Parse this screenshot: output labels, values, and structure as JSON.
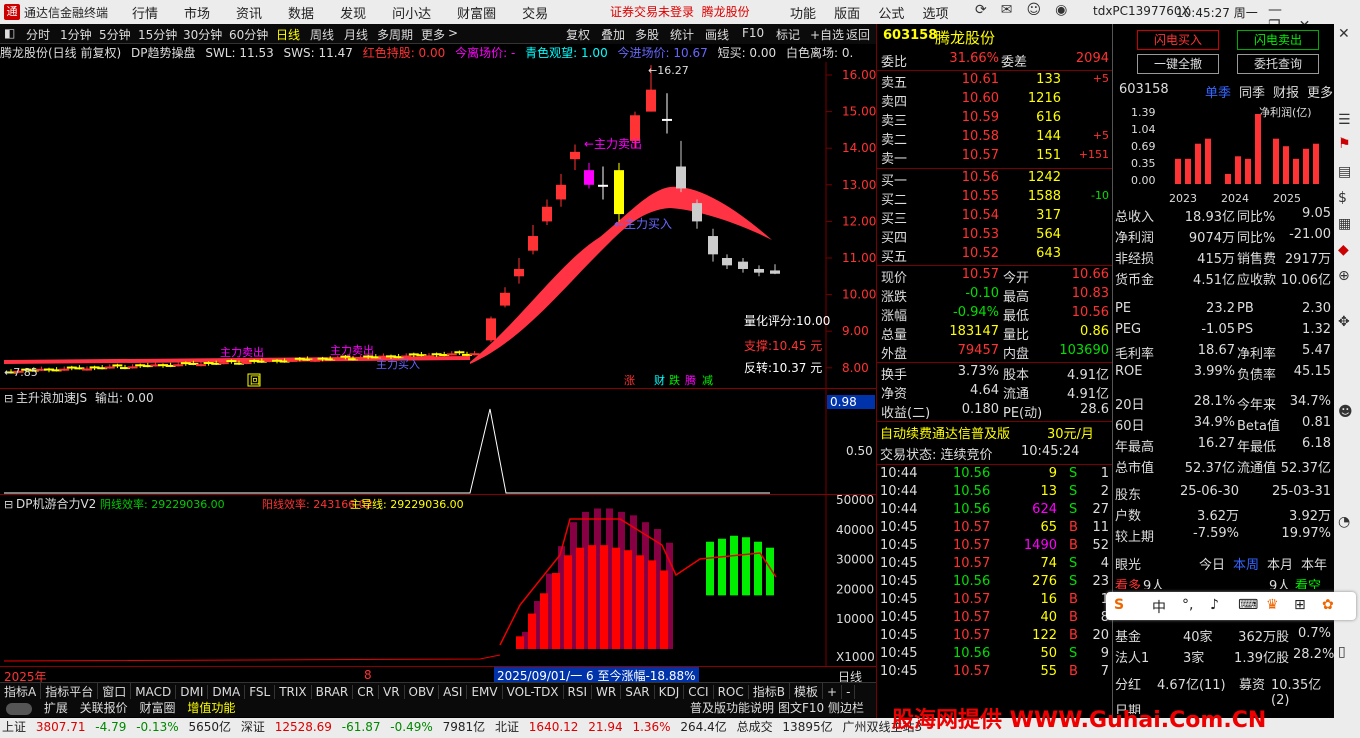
{
  "title_bar": {
    "app_name": "通达信金融终端",
    "menu": [
      "行情",
      "市场",
      "资讯",
      "数据",
      "发现",
      "问小达",
      "财富圈",
      "交易"
    ],
    "notice": "证券交易未登录",
    "notice_stock": "腾龙股份",
    "right_menu": [
      "功能",
      "版面",
      "公式",
      "选项"
    ],
    "user_id": "tdxPC1397760X",
    "clock": "10:45:27 周一"
  },
  "period_bar": {
    "items": [
      "分时",
      "1分钟",
      "5分钟",
      "15分钟",
      "30分钟",
      "60分钟",
      "日线",
      "周线",
      "月线",
      "多周期",
      "更多"
    ],
    "active": "日线",
    "right": [
      "复权",
      "叠加",
      "多股",
      "统计",
      "画线",
      "F10",
      "标记",
      "+自选",
      "返回"
    ]
  },
  "chart_info": {
    "name": "腾龙股份(日线 前复权)",
    "indicator": "DP趋势操盘",
    "swl": "SWL: 11.53",
    "sws": "SWS: 11.47",
    "red_hold": "红色持股: 0.00",
    "today_leave": "今离场价: -",
    "cyan_watch": "青色观望: 1.00",
    "today_enter": "今进场价: 10.67",
    "short_buy": "短买: 0.00",
    "white_leave": "白色离场: 0."
  },
  "main_chart": {
    "y_ticks": [
      "16.00",
      "15.00",
      "14.00",
      "13.00",
      "12.00",
      "11.00",
      "10.00",
      "9.00",
      "8.00"
    ],
    "high_label": "16.27",
    "low_label": "7.85",
    "annotations": [
      "←主力卖出",
      "←主力买入",
      "主力卖出",
      "主力买入",
      "主力卖出"
    ],
    "score": "量化评分:10.00",
    "support": "支撑:10.45 元",
    "reverse": "反转:10.37 元",
    "tags": [
      "涨",
      "财",
      "跌",
      "腾",
      "减"
    ],
    "marker": "回"
  },
  "sub1": {
    "name": "主升浪加速JS",
    "output": "输出: 0.00",
    "y_ticks": [
      "0.98",
      "0.50"
    ]
  },
  "sub2": {
    "name": "DP机游合力V2",
    "yin": "阴线效率: 29229036.00",
    "yang": "阳线效率: 243166.02",
    "main": "主导线: 29229036.00",
    "y_ticks": [
      "50000",
      "40000",
      "30000",
      "20000",
      "10000",
      "X1000"
    ]
  },
  "x_axis": {
    "labels": [
      "2025年",
      "8",
      "9"
    ],
    "range_note": "2025/09/01/一 6 至今涨幅-18.88%",
    "period": "日线"
  },
  "indicator_tabs": [
    "指标A",
    "指标平台",
    "窗口",
    "MACD",
    "DMI",
    "DMA",
    "FSL",
    "TRIX",
    "BRAR",
    "CR",
    "VR",
    "OBV",
    "ASI",
    "EMV",
    "VOL-TDX",
    "RSI",
    "WR",
    "SAR",
    "KDJ",
    "CCI",
    "ROC",
    "指标B",
    "模板",
    "+",
    "-"
  ],
  "bottom_tabs": [
    "扩展",
    "关联报价",
    "财富圈",
    "增值功能"
  ],
  "bottom_right": [
    "普及版功能说明",
    "图文F10",
    "侧边栏"
  ],
  "quote": {
    "code": "603158",
    "name": "腾龙股份",
    "weibi_label": "委比",
    "weibi": "31.66%",
    "weicha_label": "委差",
    "weicha": "2094",
    "asks": [
      {
        "label": "卖五",
        "price": "10.61",
        "vol": "133",
        "chg": "+5"
      },
      {
        "label": "卖四",
        "price": "10.60",
        "vol": "1216",
        "chg": ""
      },
      {
        "label": "卖三",
        "price": "10.59",
        "vol": "616",
        "chg": ""
      },
      {
        "label": "卖二",
        "price": "10.58",
        "vol": "144",
        "chg": "+5"
      },
      {
        "label": "卖一",
        "price": "10.57",
        "vol": "151",
        "chg": "+151"
      }
    ],
    "bids": [
      {
        "label": "买一",
        "price": "10.56",
        "vol": "1242",
        "chg": ""
      },
      {
        "label": "买二",
        "price": "10.55",
        "vol": "1588",
        "chg": "-10"
      },
      {
        "label": "买三",
        "price": "10.54",
        "vol": "317",
        "chg": ""
      },
      {
        "label": "买四",
        "price": "10.53",
        "vol": "564",
        "chg": ""
      },
      {
        "label": "买五",
        "price": "10.52",
        "vol": "643",
        "chg": ""
      }
    ],
    "stats": [
      {
        "l1": "现价",
        "v1": "10.57",
        "c1": "red",
        "l2": "今开",
        "v2": "10.66",
        "c2": "red"
      },
      {
        "l1": "涨跌",
        "v1": "-0.10",
        "c1": "green",
        "l2": "最高",
        "v2": "10.83",
        "c2": "red"
      },
      {
        "l1": "涨幅",
        "v1": "-0.94%",
        "c1": "green",
        "l2": "最低",
        "v2": "10.56",
        "c2": "red"
      },
      {
        "l1": "总量",
        "v1": "183147",
        "c1": "yellow",
        "l2": "量比",
        "v2": "0.86",
        "c2": "yellow"
      },
      {
        "l1": "外盘",
        "v1": "79457",
        "c1": "red",
        "l2": "内盘",
        "v2": "103690",
        "c2": "green"
      }
    ],
    "stats2": [
      {
        "l1": "换手",
        "v1": "3.73%",
        "l2": "股本",
        "v2": "4.91亿"
      },
      {
        "l1": "净资",
        "v1": "4.64",
        "l2": "流通",
        "v2": "4.91亿"
      },
      {
        "l1": "收益(二)",
        "v1": "0.180",
        "l2": "PE(动)",
        "v2": "28.6"
      }
    ],
    "promo": "自动续费通达信普及版",
    "promo_price": "30元/月",
    "trade_status": "交易状态: 连续竞价",
    "trade_time": "10:45:24",
    "ticks": [
      {
        "t": "10:44",
        "p": "10.56",
        "v": "9",
        "s": "S",
        "n": "1"
      },
      {
        "t": "10:44",
        "p": "10.56",
        "v": "13",
        "s": "S",
        "n": "2"
      },
      {
        "t": "10:44",
        "p": "10.56",
        "v": "624",
        "s": "S",
        "n": "27"
      },
      {
        "t": "10:45",
        "p": "10.57",
        "v": "65",
        "s": "B",
        "n": "11"
      },
      {
        "t": "10:45",
        "p": "10.57",
        "v": "1490",
        "s": "B",
        "n": "52"
      },
      {
        "t": "10:45",
        "p": "10.57",
        "v": "74",
        "s": "S",
        "n": "4"
      },
      {
        "t": "10:45",
        "p": "10.56",
        "v": "276",
        "s": "S",
        "n": "23"
      },
      {
        "t": "10:45",
        "p": "10.57",
        "v": "16",
        "s": "B",
        "n": "1"
      },
      {
        "t": "10:45",
        "p": "10.57",
        "v": "40",
        "s": "B",
        "n": "8"
      },
      {
        "t": "10:45",
        "p": "10.57",
        "v": "122",
        "s": "B",
        "n": "20"
      },
      {
        "t": "10:45",
        "p": "10.56",
        "v": "50",
        "s": "S",
        "n": "9"
      },
      {
        "t": "10:45",
        "p": "10.57",
        "v": "55",
        "s": "B",
        "n": "7"
      }
    ]
  },
  "rpanel": {
    "btn_flash_buy": "闪电买入",
    "btn_flash_sell": "闪电卖出",
    "btn_clear": "一键全撤",
    "btn_query": "委托查询",
    "code": "603158",
    "tabs": [
      "单季",
      "同季",
      "财报",
      "更多"
    ],
    "profit_label": "净利润(亿)",
    "mini_y": [
      "1.39",
      "1.04",
      "0.69",
      "0.35",
      "0.00"
    ],
    "mini_x": [
      "2023",
      "2024",
      "2025"
    ],
    "fin": [
      {
        "a": "总收入",
        "b": "18.93亿",
        "c": "同比%",
        "d": "9.05"
      },
      {
        "a": "净利润",
        "b": "9074万",
        "c": "同比%",
        "d": "-21.00"
      },
      {
        "a": "非经损",
        "b": "415万",
        "c": "销售费",
        "d": "2917万"
      },
      {
        "a": "货币金",
        "b": "4.51亿",
        "c": "应收款",
        "d": "10.06亿"
      }
    ],
    "fin2": [
      {
        "a": "PE",
        "b": "23.2",
        "c": "PB",
        "d": "2.30"
      },
      {
        "a": "PEG",
        "b": "-1.05",
        "c": "PS",
        "d": "1.32"
      },
      {
        "a": "毛利率",
        "b": "18.67",
        "c": "净利率",
        "d": "5.47"
      },
      {
        "a": "ROE",
        "b": "3.99%",
        "c": "负债率",
        "d": "45.15"
      }
    ],
    "fin3": [
      {
        "a": "20日",
        "b": "28.1%",
        "c": "今年来",
        "d": "34.7%"
      },
      {
        "a": "60日",
        "b": "34.9%",
        "c": "Beta值",
        "d": "0.81"
      },
      {
        "a": "年最高",
        "b": "16.27",
        "c": "年最低",
        "d": "6.18"
      },
      {
        "a": "总市值",
        "b": "52.37亿",
        "c": "流通值",
        "d": "52.37亿"
      }
    ],
    "holders": [
      {
        "a": "股东",
        "b": "25-06-30",
        "c": "25-03-31"
      },
      {
        "a": "户数",
        "b": "3.62万",
        "c": "3.92万"
      },
      {
        "a": "较上期",
        "b": "-7.59%",
        "c": "19.97%"
      }
    ],
    "eye": "眼光",
    "eye_tabs": [
      "今日",
      "本周",
      "本月",
      "本年"
    ],
    "eye_row": {
      "a": "看多",
      "b": "9人",
      "c": "9人",
      "d": "看空"
    },
    "inst": [
      {
        "a": "基金",
        "b": "40家",
        "c": "362万股",
        "d": "0.7%"
      },
      {
        "a": "法人1",
        "b": "3家",
        "c": "1.39亿股",
        "d": "28.2%"
      }
    ],
    "dividend": {
      "a": "分红",
      "b": "4.67亿(11)",
      "c": "募资",
      "d": "10.35亿(2)"
    },
    "last": "日期"
  },
  "statusbar": {
    "sh_label": "上证",
    "sh": "3807.71",
    "sh_chg": "-4.79",
    "sh_pct": "-0.13%",
    "sh_amt": "5650亿",
    "sz_label": "深证",
    "sz": "12528.69",
    "sz_chg": "-61.87",
    "sz_pct": "-0.49%",
    "sz_amt": "7981亿",
    "bz_label": "北证",
    "bz": "1640.12",
    "bz_chg": "21.94",
    "bz_pct": "1.36%",
    "bz_amt": "264.4亿",
    "total_label": "总成交",
    "total": "13895亿",
    "site": "广州双线主站3"
  },
  "ime": {
    "items": [
      "中",
      "°,",
      "🎤",
      "⌨",
      "👕",
      "⊞",
      "🎨"
    ]
  },
  "watermark": "股海网提供 WWW.Guhai.Com.CN",
  "colors": {
    "up": "#ff3232",
    "down": "#00e000",
    "accent": "#ffff00",
    "border": "#770000"
  }
}
